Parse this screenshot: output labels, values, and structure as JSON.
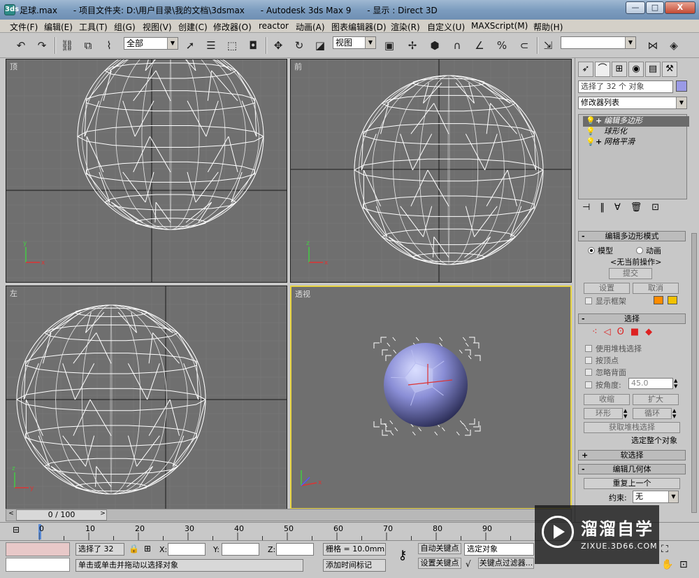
{
  "window": {
    "title": "足球.max      - 项目文件夹: D:\\用户目录\\我的文档\\3dsmax      - Autodesk 3ds Max 9      - 显示 : Direct 3D",
    "app_icon": "3ds",
    "controls": [
      "—",
      "□",
      "X"
    ]
  },
  "menu": [
    "文件(F)",
    "编辑(E)",
    "工具(T)",
    "组(G)",
    "视图(V)",
    "创建(C)",
    "修改器(O)",
    "reactor",
    "动画(A)",
    "图表编辑器(D)",
    "渲染(R)",
    "自定义(U)",
    "MAXScript(M)",
    "帮助(H)"
  ],
  "toolbar": {
    "selection_filter": "全部",
    "coord_system": "视图",
    "named_selection": ""
  },
  "viewports": {
    "top": "顶",
    "front": "前",
    "left": "左",
    "perspective": "透视"
  },
  "command_panel": {
    "selection_info": "选择了 32 个 对象",
    "modifier_list": "修改器列表",
    "stack": [
      "编辑多边形",
      "球形化",
      "网格平滑"
    ],
    "edit_poly_mode": {
      "title": "编辑多边形模式",
      "mode_model": "模型",
      "mode_animation": "动画",
      "no_operation": "<无当前操作>",
      "commit": "提交",
      "settings": "设置",
      "cancel": "取消",
      "show_cage": "显示框架",
      "cage_color_1": "#ff8c00",
      "cage_color_2": "#f2c200"
    },
    "selection": {
      "title": "选择",
      "use_stack_selection": "使用堆栈选择",
      "by_vertex": "按顶点",
      "ignore_backfacing": "忽略背面",
      "by_angle": "按角度:",
      "angle_value": "45.0",
      "shrink": "收缩",
      "grow": "扩大",
      "ring": "环形",
      "loop": "循环",
      "get_stack_selection": "获取堆栈选择",
      "whole_object_selected": "选定整个对象"
    },
    "soft_selection": "软选择",
    "edit_geometry": {
      "title": "编辑几何体",
      "repeat_last": "重复上一个",
      "constraints_label": "约束:",
      "constraints_value": "无"
    }
  },
  "timeline": {
    "frame_display": "0 / 100",
    "ticks": [
      "0",
      "10",
      "20",
      "30",
      "40",
      "50",
      "60",
      "70",
      "80",
      "90"
    ]
  },
  "status": {
    "selected": "选择了 32",
    "x_label": "X:",
    "y_label": "Y:",
    "z_label": "Z:",
    "grid": "栅格 = 10.0mm",
    "auto_key": "自动关键点",
    "set_key": "设置关键点",
    "key_mode": "选定对象",
    "key_filters": "关键点过滤器...",
    "prompt": "单击或单击并拖动以选择对象",
    "add_time_tag": "添加时间标记"
  },
  "watermark": {
    "brand": "溜溜自学",
    "url": "ZIXUE.3D66.COM"
  }
}
